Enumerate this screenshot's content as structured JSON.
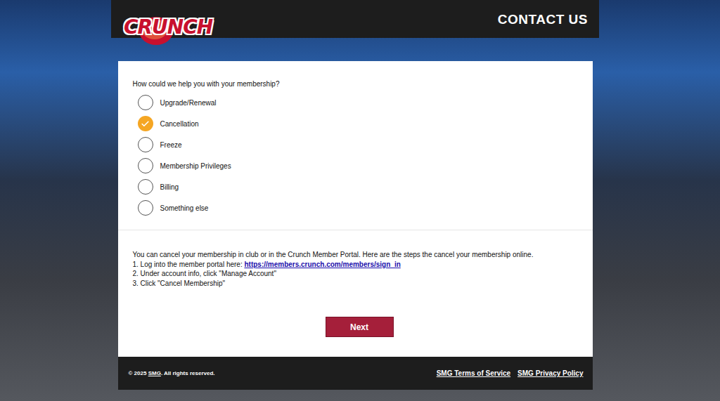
{
  "header": {
    "logo": "CRUNCH",
    "title": "CONTACT US"
  },
  "form": {
    "question": "How could we help you with your membership?",
    "options": [
      {
        "label": "Upgrade/Renewal",
        "selected": false
      },
      {
        "label": "Cancellation",
        "selected": true
      },
      {
        "label": "Freeze",
        "selected": false
      },
      {
        "label": "Membership Privileges",
        "selected": false
      },
      {
        "label": "Billing",
        "selected": false
      },
      {
        "label": "Something else",
        "selected": false
      }
    ]
  },
  "info": {
    "intro": "You can cancel your membership in club or in the Crunch Member Portal. Here are the steps the cancel your membership online.",
    "steps": [
      {
        "text": "1. Log into the member portal here: ",
        "link": "https://members.crunch.com/members/sign_in"
      },
      {
        "text": "2. Under account info, click \"Manage Account\"",
        "link": ""
      },
      {
        "text": "3. Click \"Cancel Membership\"",
        "link": ""
      }
    ]
  },
  "button": "Next",
  "footer": {
    "copyright_prefix": "© 2025 ",
    "copyright_link": "SMG",
    "copyright_suffix": ". All rights reserved.",
    "links": [
      "SMG Terms of Service",
      "SMG Privacy Policy"
    ]
  }
}
